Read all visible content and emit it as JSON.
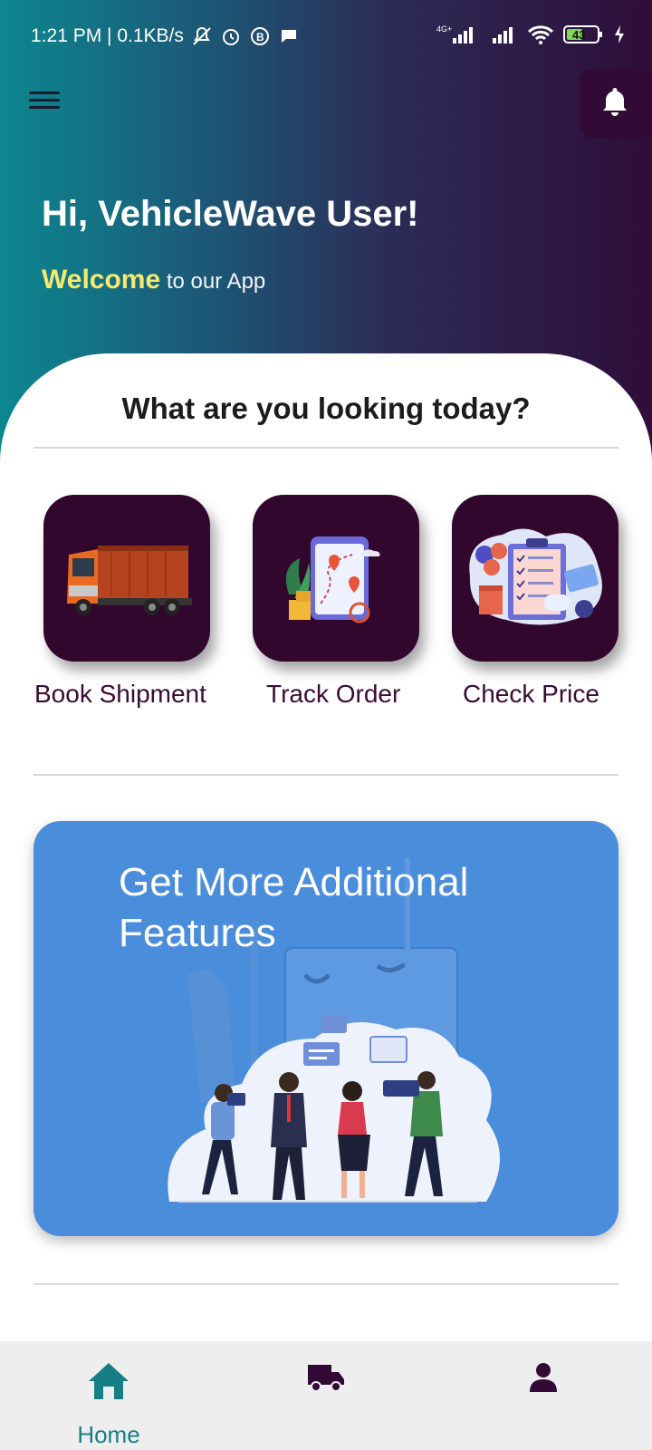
{
  "status_bar": {
    "time_and_speed": "1:21 PM | 0.1KB/s",
    "network_type": "4G+",
    "battery_level": "43"
  },
  "header": {
    "greeting": "Hi, VehicleWave User!",
    "welcome_word": "Welcome",
    "welcome_rest": " to our App"
  },
  "main": {
    "section_title": "What are you looking today?",
    "services": [
      {
        "label": "Book Shipment",
        "icon": "truck-illustration"
      },
      {
        "label": "Track Order",
        "icon": "map-tracking-illustration"
      },
      {
        "label": "Check Price",
        "icon": "price-checklist-illustration"
      }
    ],
    "promo": {
      "title": "Get More Additional Features",
      "illustration": "press-interview-illustration"
    }
  },
  "bottom_nav": {
    "items": [
      {
        "label": "Home",
        "icon": "home-icon",
        "active": true
      },
      {
        "label": "",
        "icon": "truck-icon",
        "active": false
      },
      {
        "label": "",
        "icon": "profile-icon",
        "active": false
      }
    ]
  },
  "colors": {
    "accent_teal": "#167f86",
    "tile_purple": "#32072e",
    "welcome_yellow": "#f5ea6e",
    "promo_blue": "#4a8ddb"
  }
}
